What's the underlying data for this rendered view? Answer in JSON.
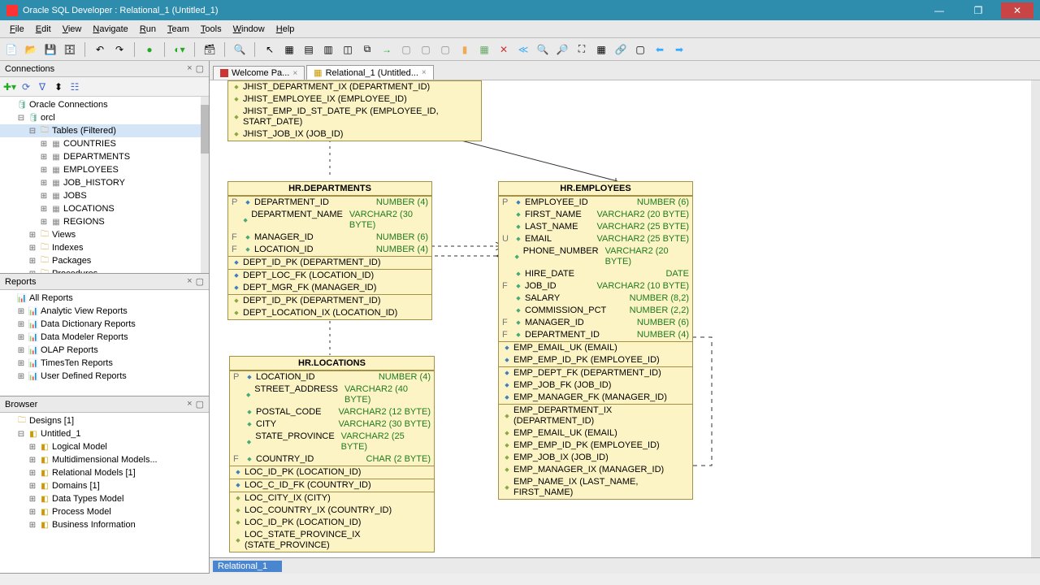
{
  "title": "Oracle SQL Developer : Relational_1 (Untitled_1)",
  "menu": [
    "File",
    "Edit",
    "View",
    "Navigate",
    "Run",
    "Team",
    "Tools",
    "Window",
    "Help"
  ],
  "panels": {
    "connections": {
      "title": "Connections",
      "root": "Oracle Connections",
      "db": "orcl",
      "tablesLabel": "Tables (Filtered)",
      "tables": [
        "COUNTRIES",
        "DEPARTMENTS",
        "EMPLOYEES",
        "JOB_HISTORY",
        "JOBS",
        "LOCATIONS",
        "REGIONS"
      ],
      "nodes": [
        "Views",
        "Indexes",
        "Packages",
        "Procedures"
      ]
    },
    "reports": {
      "title": "Reports",
      "items": [
        "All Reports",
        "Analytic View Reports",
        "Data Dictionary Reports",
        "Data Modeler Reports",
        "OLAP Reports",
        "TimesTen Reports",
        "User Defined Reports"
      ]
    },
    "browser": {
      "title": "Browser",
      "designs": "Designs [1]",
      "untitled": "Untitled_1",
      "items": [
        "Logical Model",
        "Multidimensional Models...",
        "Relational Models [1]",
        "Domains [1]",
        "Data Types Model",
        "Process Model",
        "Business Information"
      ]
    }
  },
  "tabs": {
    "welcome": "Welcome Pa...",
    "relational": "Relational_1 (Untitled..."
  },
  "bottomTab": "Relational_1",
  "entities": {
    "jhist_frag": {
      "rows": [
        "JHIST_DEPARTMENT_IX (DEPARTMENT_ID)",
        "JHIST_EMPLOYEE_IX (EMPLOYEE_ID)",
        "JHIST_EMP_ID_ST_DATE_PK (EMPLOYEE_ID, START_DATE)",
        "JHIST_JOB_IX (JOB_ID)"
      ]
    },
    "departments": {
      "title": "HR.DEPARTMENTS",
      "cols": [
        {
          "f": "P",
          "n": "DEPARTMENT_ID",
          "t": "NUMBER (4)",
          "d": "p"
        },
        {
          "f": "",
          "n": "DEPARTMENT_NAME",
          "t": "VARCHAR2 (30 BYTE)",
          "d": "g"
        },
        {
          "f": "F",
          "n": "MANAGER_ID",
          "t": "NUMBER (6)",
          "d": "f"
        },
        {
          "f": "F",
          "n": "LOCATION_ID",
          "t": "NUMBER (4)",
          "d": "f"
        }
      ],
      "pk": [
        "DEPT_ID_PK (DEPARTMENT_ID)"
      ],
      "fk": [
        "DEPT_LOC_FK (LOCATION_ID)",
        "DEPT_MGR_FK (MANAGER_ID)"
      ],
      "ix": [
        "DEPT_ID_PK (DEPARTMENT_ID)",
        "DEPT_LOCATION_IX (LOCATION_ID)"
      ]
    },
    "employees": {
      "title": "HR.EMPLOYEES",
      "cols": [
        {
          "f": "P",
          "n": "EMPLOYEE_ID",
          "t": "NUMBER (6)",
          "d": "p"
        },
        {
          "f": "",
          "n": "FIRST_NAME",
          "t": "VARCHAR2 (20 BYTE)",
          "d": "g"
        },
        {
          "f": "",
          "n": "LAST_NAME",
          "t": "VARCHAR2 (25 BYTE)",
          "d": "g"
        },
        {
          "f": "U",
          "n": "EMAIL",
          "t": "VARCHAR2 (25 BYTE)",
          "d": "g"
        },
        {
          "f": "",
          "n": "PHONE_NUMBER",
          "t": "VARCHAR2 (20 BYTE)",
          "d": "g"
        },
        {
          "f": "",
          "n": "HIRE_DATE",
          "t": "DATE",
          "d": "g"
        },
        {
          "f": "F",
          "n": "JOB_ID",
          "t": "VARCHAR2 (10 BYTE)",
          "d": "f"
        },
        {
          "f": "",
          "n": "SALARY",
          "t": "NUMBER (8,2)",
          "d": "g"
        },
        {
          "f": "",
          "n": "COMMISSION_PCT",
          "t": "NUMBER (2,2)",
          "d": "g"
        },
        {
          "f": "F",
          "n": "MANAGER_ID",
          "t": "NUMBER (6)",
          "d": "f"
        },
        {
          "f": "F",
          "n": "DEPARTMENT_ID",
          "t": "NUMBER (4)",
          "d": "f"
        }
      ],
      "uk": [
        "EMP_EMAIL_UK (EMAIL)",
        "EMP_EMP_ID_PK (EMPLOYEE_ID)"
      ],
      "fk": [
        "EMP_DEPT_FK (DEPARTMENT_ID)",
        "EMP_JOB_FK (JOB_ID)",
        "EMP_MANAGER_FK (MANAGER_ID)"
      ],
      "ix": [
        "EMP_DEPARTMENT_IX (DEPARTMENT_ID)",
        "EMP_EMAIL_UK (EMAIL)",
        "EMP_EMP_ID_PK (EMPLOYEE_ID)",
        "EMP_JOB_IX (JOB_ID)",
        "EMP_MANAGER_IX (MANAGER_ID)",
        "EMP_NAME_IX (LAST_NAME, FIRST_NAME)"
      ]
    },
    "locations": {
      "title": "HR.LOCATIONS",
      "cols": [
        {
          "f": "P",
          "n": "LOCATION_ID",
          "t": "NUMBER (4)",
          "d": "p"
        },
        {
          "f": "",
          "n": "STREET_ADDRESS",
          "t": "VARCHAR2 (40 BYTE)",
          "d": "g"
        },
        {
          "f": "",
          "n": "POSTAL_CODE",
          "t": "VARCHAR2 (12 BYTE)",
          "d": "g"
        },
        {
          "f": "",
          "n": "CITY",
          "t": "VARCHAR2 (30 BYTE)",
          "d": "g"
        },
        {
          "f": "",
          "n": "STATE_PROVINCE",
          "t": "VARCHAR2 (25 BYTE)",
          "d": "g"
        },
        {
          "f": "F",
          "n": "COUNTRY_ID",
          "t": "CHAR (2 BYTE)",
          "d": "f"
        }
      ],
      "pk": [
        "LOC_ID_PK (LOCATION_ID)"
      ],
      "fk": [
        "LOC_C_ID_FK (COUNTRY_ID)"
      ],
      "ix": [
        "LOC_CITY_IX (CITY)",
        "LOC_COUNTRY_IX (COUNTRY_ID)",
        "LOC_ID_PK (LOCATION_ID)",
        "LOC_STATE_PROVINCE_IX (STATE_PROVINCE)"
      ]
    }
  }
}
